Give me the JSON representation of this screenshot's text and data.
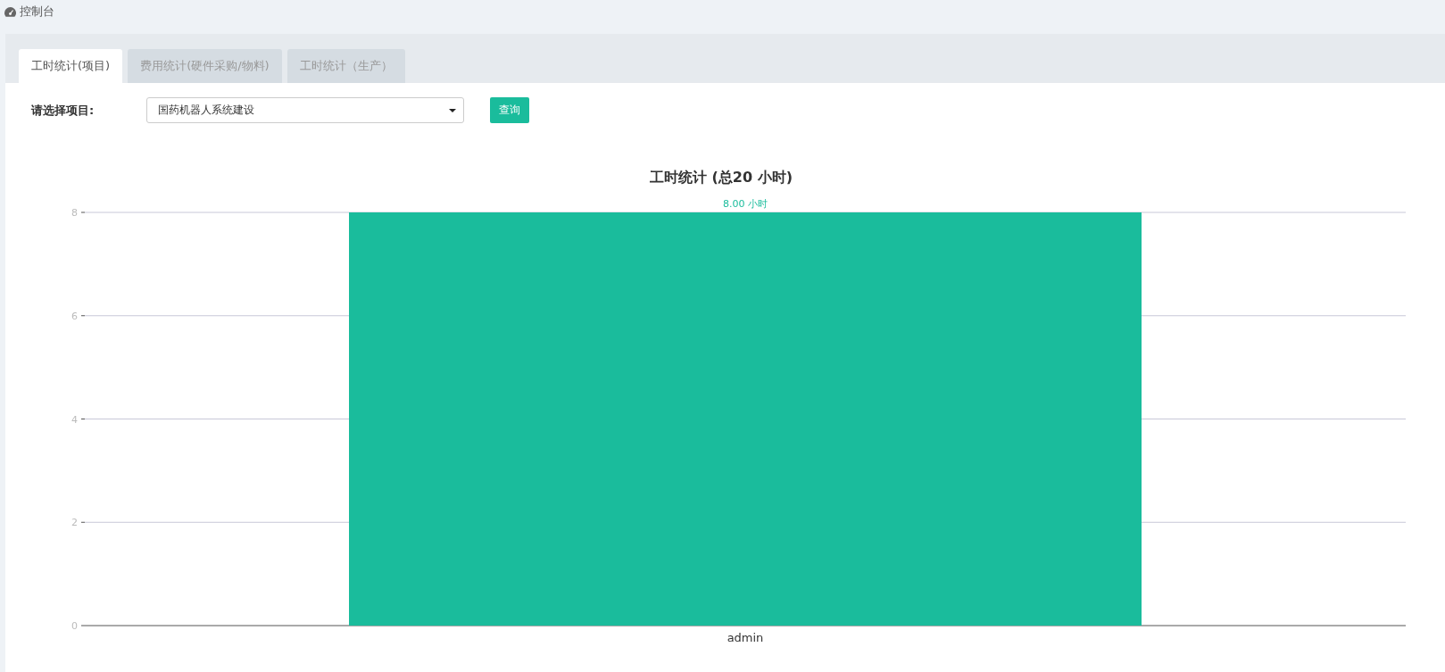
{
  "breadcrumb": {
    "title": "控制台"
  },
  "tabs": [
    {
      "label": "工时统计(项目)",
      "selected": true
    },
    {
      "label": "费用统计(硬件采购/物料)",
      "selected": false
    },
    {
      "label": "工时统计（生产）",
      "selected": false
    }
  ],
  "filter": {
    "label": "请选择项目:",
    "value": "国药机器人系统建设",
    "button": "查询"
  },
  "chart": {
    "chart_data": {
      "type": "bar",
      "title": "工时统计 (总20 小时)",
      "categories": [
        "admin"
      ],
      "series": [
        {
          "color": "#1abc9c",
          "values": [
            8
          ]
        }
      ],
      "grid": true,
      "ylim": [
        0,
        8
      ],
      "yticks": [
        0,
        2,
        4,
        6,
        8
      ],
      "value_labels": [
        "8.00 小时"
      ]
    }
  }
}
